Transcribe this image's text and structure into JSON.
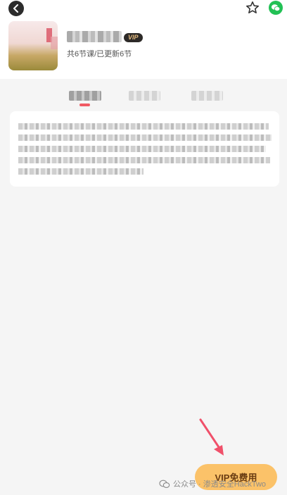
{
  "course": {
    "lesson_count": "共6节课/已更新6节",
    "vip_badge": "VIP"
  },
  "actions": {
    "vip_free_label": "VIP免费用"
  },
  "watermark": {
    "text": "公众号 · 渗透安全HackTwo"
  },
  "icons": {
    "back": "back-arrow-icon",
    "star": "star-icon",
    "share": "wechat-icon",
    "annotation": "red-arrow-icon"
  },
  "colors": {
    "accent": "#f05a64",
    "vip_button": "#fbc269",
    "vip_text": "#6a3c12",
    "wechat": "#22c155"
  }
}
